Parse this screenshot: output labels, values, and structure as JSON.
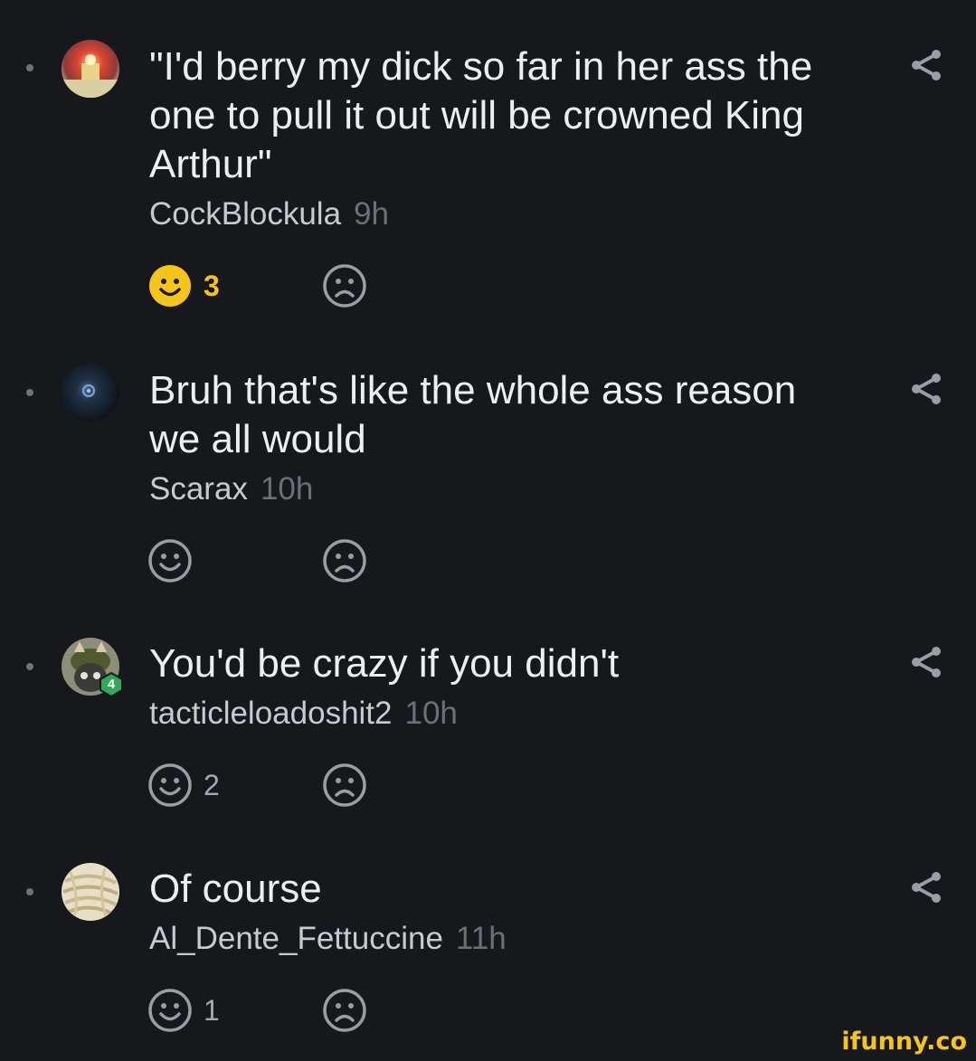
{
  "comments": [
    {
      "text": "\"I'd berry my dick so far in her ass the one to pull it out will be crowned King Arthur\"",
      "username": "CockBlockula",
      "time": "9h",
      "likes": "3",
      "liked": true,
      "avatar": "red-glow-figure-avatar"
    },
    {
      "text": "Bruh that's like the whole ass reason we all would",
      "username": "Scarax",
      "time": "10h",
      "likes": "",
      "liked": false,
      "avatar": "dark-orb-avatar"
    },
    {
      "text": "You'd be crazy if you didn't",
      "username": "tacticleloadoshit2",
      "time": "10h",
      "likes": "2",
      "liked": false,
      "avatar": "cat-helmet-avatar",
      "level_badge": "4"
    },
    {
      "text": "Of course",
      "username": "Al_Dente_Fettuccine",
      "time": "11h",
      "likes": "1",
      "liked": false,
      "avatar": "fettuccine-avatar"
    }
  ],
  "icons": {
    "like": "smile-icon",
    "dislike": "frown-icon",
    "share": "share-icon",
    "bullet": "bullet-dot"
  },
  "colors": {
    "background": "#17181c",
    "text": "#eceef1",
    "username": "#c7cad0",
    "time": "#6c6f76",
    "icon_gray": "#9a9da4",
    "like_active": "#f5c518",
    "badge_green": "#2eaa5a"
  },
  "watermark": "ifunny.co"
}
